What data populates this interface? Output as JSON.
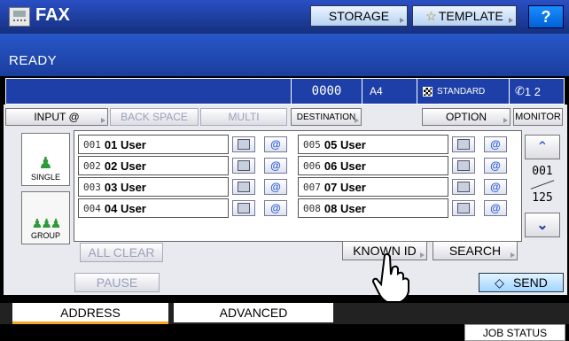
{
  "titlebar": {
    "title": "FAX",
    "storage_label": "STORAGE",
    "template_label": "TEMPLATE",
    "help_label": "?"
  },
  "status": {
    "text": "READY"
  },
  "info": {
    "counter": "0000",
    "paper": "A4",
    "quality": "STANDARD",
    "lines": "1 2"
  },
  "toolbar": {
    "input": "INPUT @",
    "backspace": "BACK SPACE",
    "multi": "MULTI",
    "destination": "DESTINATION",
    "option": "OPTION",
    "monitor": "MONITOR"
  },
  "sidetabs": {
    "single": "SINGLE",
    "group": "GROUP"
  },
  "entries": [
    {
      "num": "001",
      "name": "01 User"
    },
    {
      "num": "002",
      "name": "02 User"
    },
    {
      "num": "003",
      "name": "03 User"
    },
    {
      "num": "004",
      "name": "04 User"
    },
    {
      "num": "005",
      "name": "05 User"
    },
    {
      "num": "006",
      "name": "06 User"
    },
    {
      "num": "007",
      "name": "07 User"
    },
    {
      "num": "008",
      "name": "08 User"
    }
  ],
  "pager": {
    "current": "001",
    "total": "125"
  },
  "actions": {
    "all_clear": "ALL CLEAR",
    "known_id": "KNOWN ID",
    "search": "SEARCH",
    "pause": "PAUSE",
    "send": "SEND"
  },
  "tabs": {
    "address": "ADDRESS",
    "advanced": "ADVANCED"
  },
  "footer": {
    "job_status": "JOB STATUS"
  },
  "colors": {
    "title_bg": "#1b3a9c",
    "accent": "#f5a623",
    "send_bg": "#bfe4ff"
  }
}
